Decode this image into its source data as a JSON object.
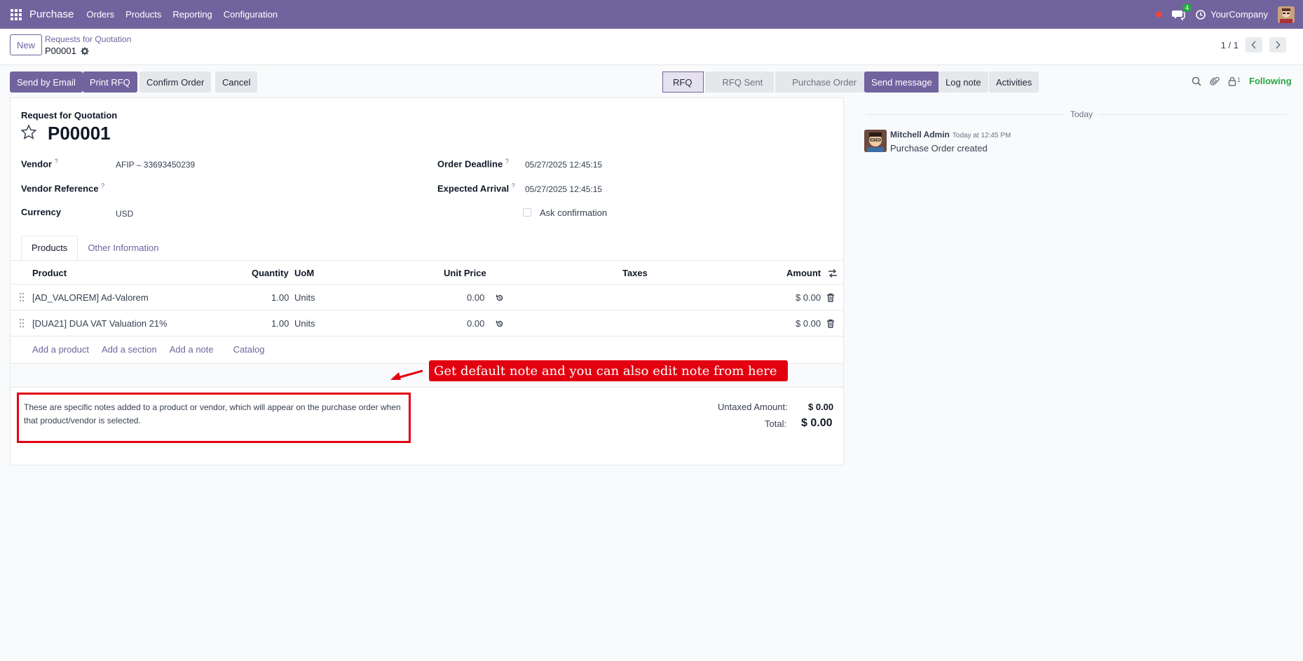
{
  "topnav": {
    "app_name": "Purchase",
    "menu": [
      "Orders",
      "Products",
      "Reporting",
      "Configuration"
    ],
    "chat_badge": "4",
    "company": "YourCompany"
  },
  "controlpanel": {
    "new_label": "New",
    "breadcrumb_parent": "Requests for Quotation",
    "breadcrumb_current": "P00001",
    "pager": "1 / 1"
  },
  "actions": {
    "send_email": "Send by Email",
    "print_rfq": "Print RFQ",
    "confirm": "Confirm Order",
    "cancel": "Cancel"
  },
  "statusbar": [
    "RFQ",
    "RFQ Sent",
    "Purchase Order"
  ],
  "form": {
    "doc_type": "Request for Quotation",
    "doc_name": "P00001",
    "vendor_label": "Vendor",
    "vendor_value": "AFIP – 33693450239",
    "vendor_ref_label": "Vendor Reference",
    "currency_label": "Currency",
    "currency_value": "USD",
    "deadline_label": "Order Deadline",
    "deadline_value": "05/27/2025 12:45:15",
    "arrival_label": "Expected Arrival",
    "arrival_value": "05/27/2025 12:45:15",
    "ask_confirmation": "Ask confirmation",
    "help_mark": "?"
  },
  "tabs": [
    "Products",
    "Other Information"
  ],
  "table": {
    "headers": {
      "product": "Product",
      "quantity": "Quantity",
      "uom": "UoM",
      "unit_price": "Unit Price",
      "taxes": "Taxes",
      "amount": "Amount"
    },
    "rows": [
      {
        "product": "[AD_VALOREM] Ad-Valorem",
        "quantity": "1.00",
        "uom": "Units",
        "unit_price": "0.00",
        "amount": "$ 0.00"
      },
      {
        "product": "[DUA21] DUA VAT Valuation 21%",
        "quantity": "1.00",
        "uom": "Units",
        "unit_price": "0.00",
        "amount": "$ 0.00"
      }
    ],
    "add_links": [
      "Add a product",
      "Add a section",
      "Add a note",
      "Catalog"
    ]
  },
  "note": "These are specific notes added to a product or vendor, which will appear on the purchase order when that product/vendor is selected.",
  "annotation": "Get default note and you can also edit note from here",
  "totals": {
    "untaxed_label": "Untaxed Amount:",
    "untaxed_value": "$ 0.00",
    "total_label": "Total:",
    "total_value": "$ 0.00"
  },
  "chatter": {
    "send_message": "Send message",
    "log_note": "Log note",
    "activities": "Activities",
    "followers_count": "1",
    "following": "Following",
    "today": "Today",
    "author": "Mitchell Admin",
    "time": "Today at 12:45 PM",
    "body": "Purchase Order created"
  },
  "colors": {
    "brand": "#71639e",
    "annotation": "#e20010",
    "following": "#28a745"
  }
}
